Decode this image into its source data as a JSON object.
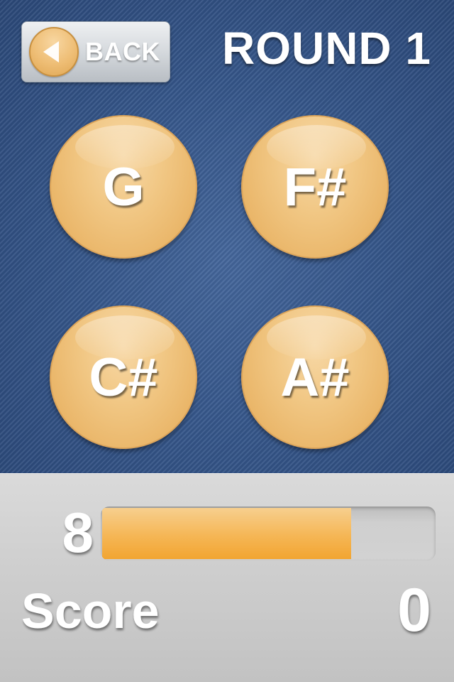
{
  "header": {
    "back_label": "BACK",
    "round_title": "ROUND 1"
  },
  "notes": [
    {
      "label": "G"
    },
    {
      "label": "F#"
    },
    {
      "label": "C#"
    },
    {
      "label": "A#"
    }
  ],
  "status": {
    "timer_value": "8",
    "timer_progress_fraction": 0.75,
    "score_label": "Score",
    "score_value": "0"
  },
  "icons": {
    "back": "arrow-left-icon"
  },
  "colors": {
    "background": "#33558a",
    "accent": "#f2a531",
    "bubble": "#f1c784",
    "panel": "#cdcdcd"
  }
}
